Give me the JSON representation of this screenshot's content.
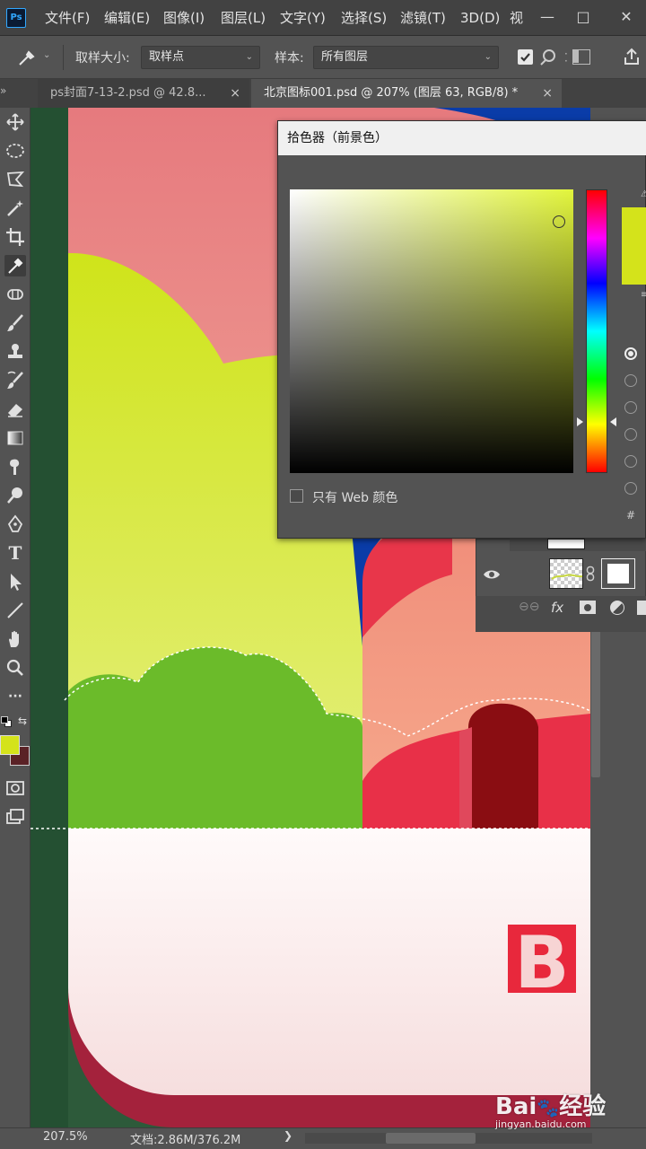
{
  "app": {
    "logo": "Ps"
  },
  "menu": {
    "items": [
      "文件(F)",
      "编辑(E)",
      "图像(I)",
      "图层(L)",
      "文字(Y)",
      "选择(S)",
      "滤镜(T)",
      "3D(D)",
      "视"
    ],
    "window_buttons": [
      "—",
      "□",
      "✕"
    ]
  },
  "options": {
    "sample_size_label": "取样大小:",
    "sample_size_value": "取样点",
    "sample_label": "样本:",
    "sample_value": "所有图层"
  },
  "tabs": [
    {
      "label": "ps封面7-13-2.psd @ 42.8...",
      "close": "×",
      "active": false
    },
    {
      "label": "北京图标001.psd @ 207% (图层 63, RGB/8) *",
      "close": "×",
      "active": true
    }
  ],
  "tools": [
    "move-tool",
    "lasso-tool",
    "polygon-lasso-tool",
    "magic-wand-tool",
    "crop-tool",
    "eyedropper-tool",
    "patch-tool",
    "brush-tool",
    "stamp-tool",
    "history-brush-tool",
    "eraser-tool",
    "gradient-tool",
    "smudge-tool",
    "dodge-tool",
    "pen-tool",
    "type-tool",
    "path-select-tool",
    "line-tool",
    "hand-tool",
    "zoom-tool",
    "more-tools"
  ],
  "tool_glyphs": {
    "type": "T",
    "more": "···"
  },
  "colors": {
    "foreground": "#d4e31b",
    "background": "#5a2226",
    "picker_hue": "#e2f53c"
  },
  "picker": {
    "title": "拾色器（前景色）",
    "web_only_label": "只有 Web 颜色",
    "hash": "#"
  },
  "layers_panel": {
    "fx": "fx"
  },
  "status": {
    "zoom": "207.5%",
    "doc": "文档:2.86M/376.2M",
    "arrow": "❯"
  },
  "canvas": {
    "letter": "B"
  },
  "watermark": {
    "brand": "Bai",
    "brand2": "经验",
    "url": "jingyan.baidu.com"
  }
}
